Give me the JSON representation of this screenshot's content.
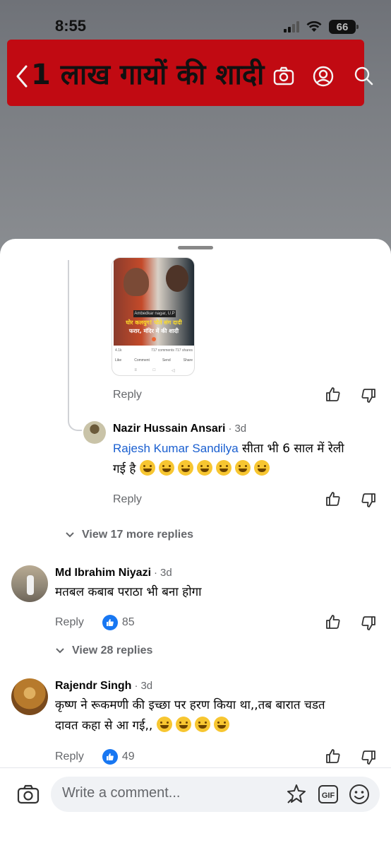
{
  "status_bar": {
    "time": "8:55",
    "battery": "66"
  },
  "video_banner": {
    "text": "1 लाख गायों की शादी"
  },
  "thumbnail": {
    "tag": "Ambedkar nagar, U.P",
    "caption_line1": "घोर कलयुग! पोते संग दादी",
    "caption_line2": "फरार, मंदिर में की शादी",
    "reactions": "4.1k",
    "comments": "717 comments",
    "shares": "717 shares",
    "actions": [
      "Like",
      "Comment",
      "Send",
      "Share"
    ]
  },
  "comments": [
    {
      "reply_label": "Reply"
    },
    {
      "name": "Nazir Hussain Ansari",
      "time": "3d",
      "mention": "Rajesh Kumar Sandilya",
      "text_line1": " सीता भी 6 साल में रेली",
      "text_line2": "गई है",
      "emoji_count": 7,
      "reply_label": "Reply"
    },
    {
      "view_more": "View 17 more replies"
    },
    {
      "name": "Md Ibrahim Niyazi",
      "time": "3d",
      "text": "मतबल कबाब पराठा भी बना होगा",
      "reply_label": "Reply",
      "like_count": "85",
      "view_more": "View 28 replies"
    },
    {
      "name": "Rajendr Singh",
      "time": "3d",
      "text_line1": "कृष्ण ने रूकमणी की इच्छा पर हरण किया था,,तब बारात चडत",
      "text_line2": "दावत कहा से आ गई,,",
      "reply_label": "Reply",
      "like_count": "49"
    }
  ],
  "composer": {
    "placeholder": "Write a comment..."
  },
  "colors": {
    "banner": "#c10a12",
    "link": "#1a5fd0",
    "like_badge": "#1877f2",
    "muted": "#65676b"
  }
}
